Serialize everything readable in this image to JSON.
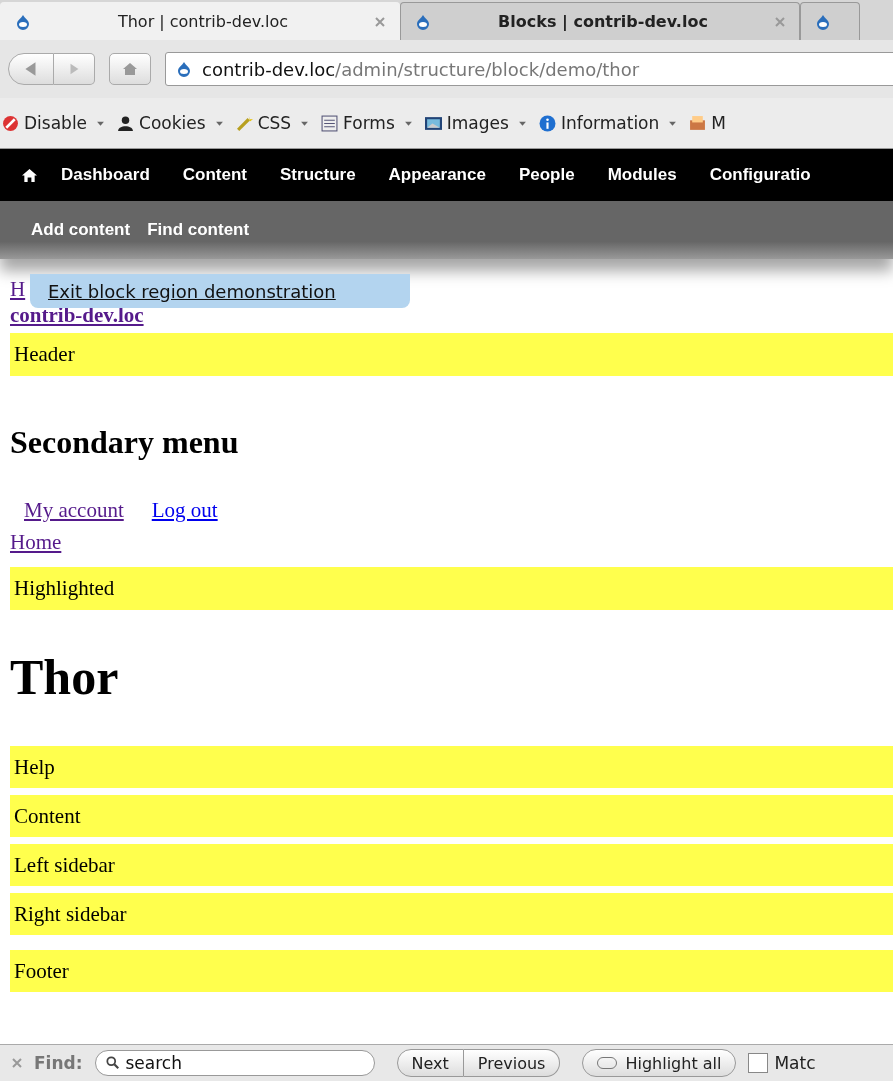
{
  "browser": {
    "tabs": [
      {
        "title": "Thor | contrib-dev.loc",
        "selected": true
      },
      {
        "title": "Blocks | contrib-dev.loc",
        "selected": false
      },
      {
        "selected": false
      }
    ],
    "address": {
      "host": "contrib-dev.loc",
      "path": "/admin/structure/block/demo/thor"
    },
    "devbar": [
      "Disable",
      "Cookies",
      "CSS",
      "Forms",
      "Images",
      "Information",
      "M"
    ]
  },
  "admin_toolbar": {
    "menu": [
      "Dashboard",
      "Content",
      "Structure",
      "Appearance",
      "People",
      "Modules",
      "Configuratio"
    ],
    "shortcuts": [
      "Add content",
      "Find content"
    ]
  },
  "demo_popup": "Exit block region demonstration",
  "site": {
    "home_link": "H",
    "site_name": "contrib-dev.loc"
  },
  "regions_top": [
    "Header"
  ],
  "secondary_menu": {
    "title": "Secondary menu",
    "links": [
      "My account",
      "Log out"
    ]
  },
  "breadcrumb": "Home",
  "regions_mid": [
    "Highlighted"
  ],
  "page_title": "Thor",
  "regions_bottom": [
    "Help",
    "Content",
    "Left sidebar",
    "Right sidebar",
    "Footer"
  ],
  "find_bar": {
    "label": "Find:",
    "value": "search",
    "buttons": [
      "Next",
      "Previous"
    ],
    "highlight": "Highlight all",
    "match_case": {
      "label": "Matc",
      "checked": false
    }
  }
}
